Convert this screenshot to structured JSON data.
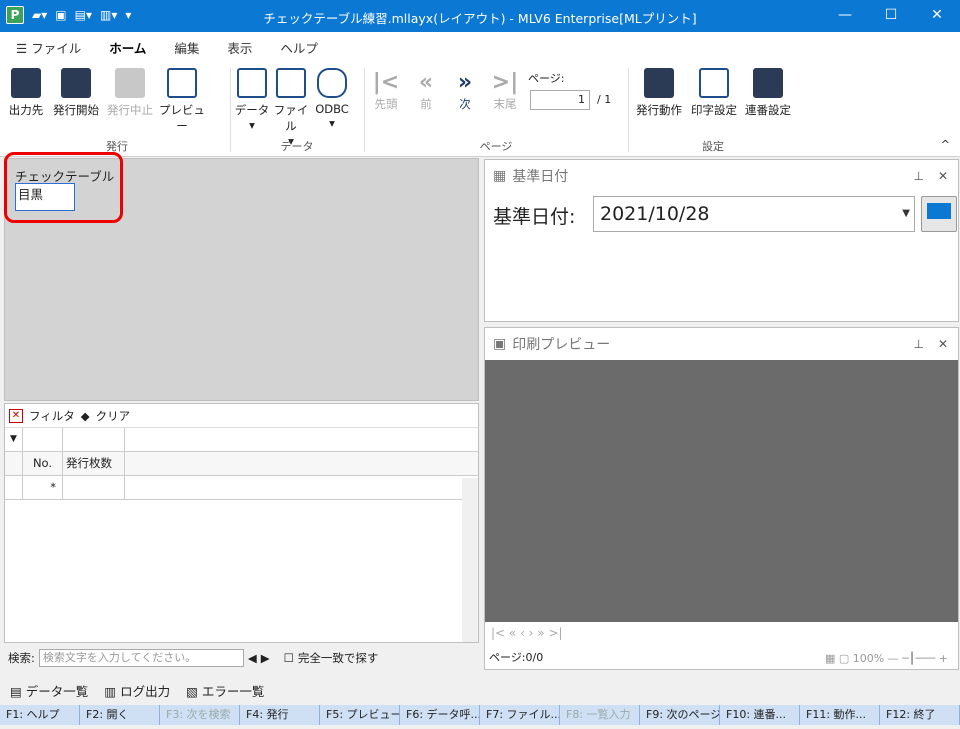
{
  "window": {
    "title": "チェックテーブル練習.mllayx(レイアウト) - MLV6 Enterprise[MLプリント]",
    "controls": [
      "—",
      "☐",
      "✕"
    ]
  },
  "menu_tabs": [
    {
      "label": "ファイル"
    },
    {
      "label": "ホーム"
    },
    {
      "label": "編集"
    },
    {
      "label": "表示"
    },
    {
      "label": "ヘルプ"
    }
  ],
  "ribbon": {
    "hakko": {
      "group": "発行",
      "buttons": [
        "出力先",
        "発行開始",
        "発行中止",
        "プレビュー"
      ]
    },
    "data": {
      "group": "データ",
      "buttons": [
        "データ",
        "ファイル",
        "ODBC"
      ]
    },
    "page": {
      "group": "ページ",
      "buttons": [
        "先頭",
        "前",
        "次",
        "末尾"
      ],
      "page_label": "ページ:",
      "page_value": "1",
      "page_total": "/ 1"
    },
    "settings": {
      "group": "設定",
      "buttons": [
        "発行動作",
        "印字設定",
        "連番設定"
      ]
    }
  },
  "designer": {
    "title": "チェックテーブル",
    "field": "目黒"
  },
  "grid": {
    "filter": "フィルタ",
    "clear": "クリア",
    "col_no": "No.",
    "col_count": "発行枚数",
    "new_row": "*"
  },
  "search": {
    "label": "検索:",
    "placeholder": "検索文字を入力してください。",
    "exact": "完全一致で探す"
  },
  "date_panel": {
    "title": "基準日付",
    "label": "基準日付:",
    "value": "2021/10/28"
  },
  "preview_panel": {
    "title": "印刷プレビュー",
    "page_status": "ページ:0/0",
    "zoom": "100%"
  },
  "status": [
    "データ一覧",
    "ログ出力",
    "エラー一覧"
  ],
  "fkeys": [
    "F1: ヘルプ",
    "F2: 開く",
    "F3: 次を検索",
    "F4: 発行",
    "F5: プレビュー",
    "F6: データ呼...",
    "F7: ファイル...",
    "F8: 一覧入力",
    "F9: 次のページ",
    "F10: 連番...",
    "F11: 動作...",
    "F12: 終了"
  ]
}
